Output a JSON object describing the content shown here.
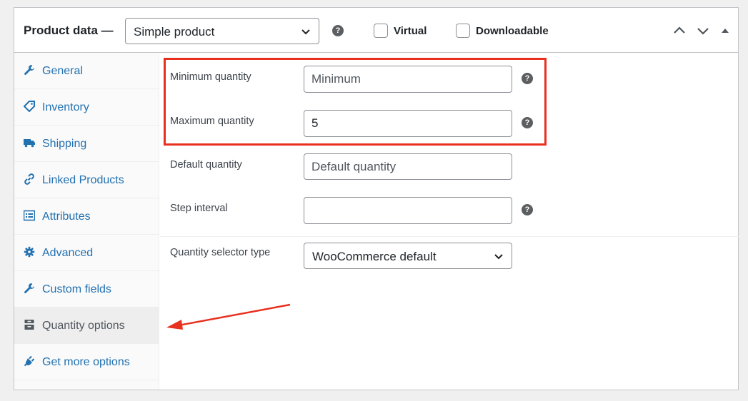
{
  "header": {
    "title": "Product data —",
    "product_type": "Simple product",
    "help_glyph": "?",
    "virtual_label": "Virtual",
    "downloadable_label": "Downloadable"
  },
  "sidebar": {
    "items": [
      {
        "label": "General",
        "icon": "wrench-icon"
      },
      {
        "label": "Inventory",
        "icon": "tag-icon"
      },
      {
        "label": "Shipping",
        "icon": "truck-icon"
      },
      {
        "label": "Linked Products",
        "icon": "link-icon"
      },
      {
        "label": "Attributes",
        "icon": "list-icon"
      },
      {
        "label": "Advanced",
        "icon": "gear-icon"
      },
      {
        "label": "Custom fields",
        "icon": "wrench-icon"
      },
      {
        "label": "Quantity options",
        "icon": "archive-icon",
        "active": true
      },
      {
        "label": "Get more options",
        "icon": "plugin-icon"
      }
    ]
  },
  "fields": {
    "minimum": {
      "label": "Minimum quantity",
      "placeholder": "Minimum",
      "value": ""
    },
    "maximum": {
      "label": "Maximum quantity",
      "placeholder": "",
      "value": "5"
    },
    "default": {
      "label": "Default quantity",
      "placeholder": "Default quantity",
      "value": ""
    },
    "step": {
      "label": "Step interval",
      "placeholder": "",
      "value": ""
    },
    "selector": {
      "label": "Quantity selector type",
      "value": "WooCommerce default"
    }
  },
  "annotation_color": "#e8301f",
  "link_color": "#2271b1"
}
